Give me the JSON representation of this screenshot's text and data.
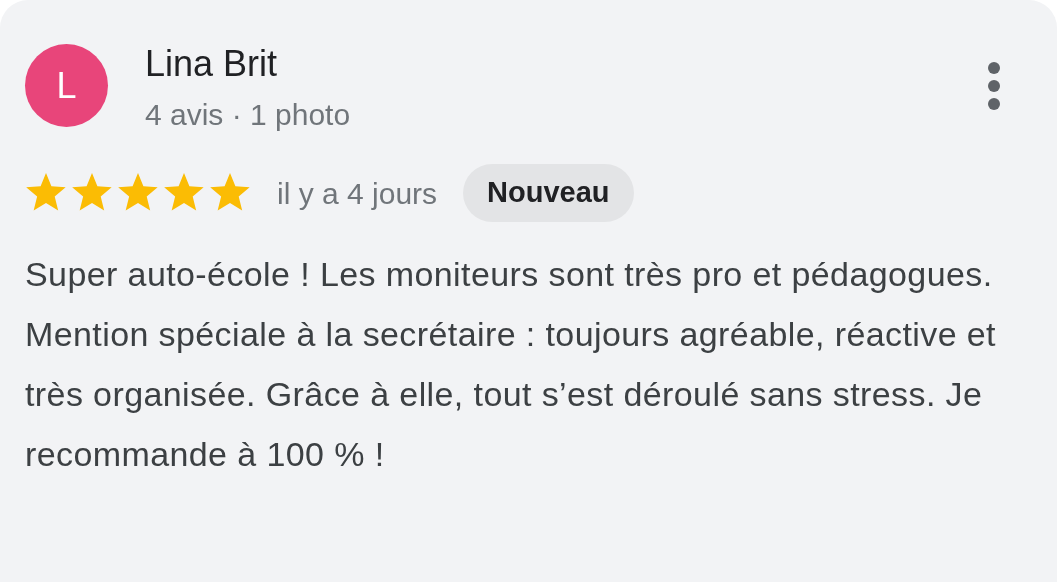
{
  "review": {
    "avatar_letter": "L",
    "author": "Lina Brit",
    "author_meta": "4 avis · 1 photo",
    "stars": 5,
    "time": "il y a 4 jours",
    "badge": "Nouveau",
    "text": "Super auto-école ! Les moniteurs sont très pro et pédagogues. Mention spéciale à la secrétaire : toujours agréable, réactive et très organisée. Grâce à elle, tout s’est déroulé sans stress. Je recommande à 100 % !"
  }
}
